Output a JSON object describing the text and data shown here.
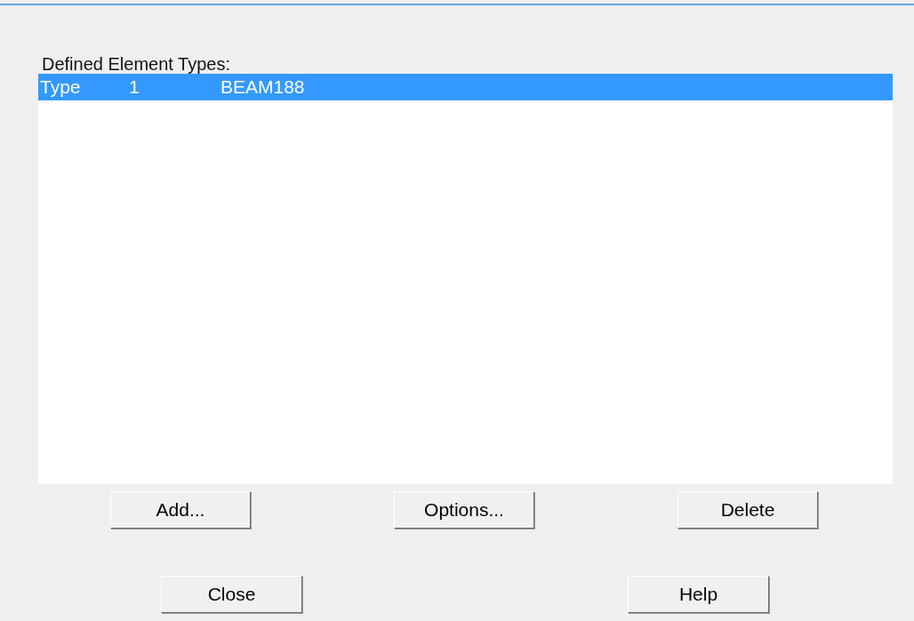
{
  "list_label": "Defined Element Types:",
  "rows": [
    {
      "cells": [
        "Type",
        "1",
        "BEAM188"
      ],
      "selected": true
    }
  ],
  "action_buttons": [
    "Add...",
    "Options...",
    "Delete"
  ],
  "footer_buttons": [
    "Close",
    "Help"
  ]
}
